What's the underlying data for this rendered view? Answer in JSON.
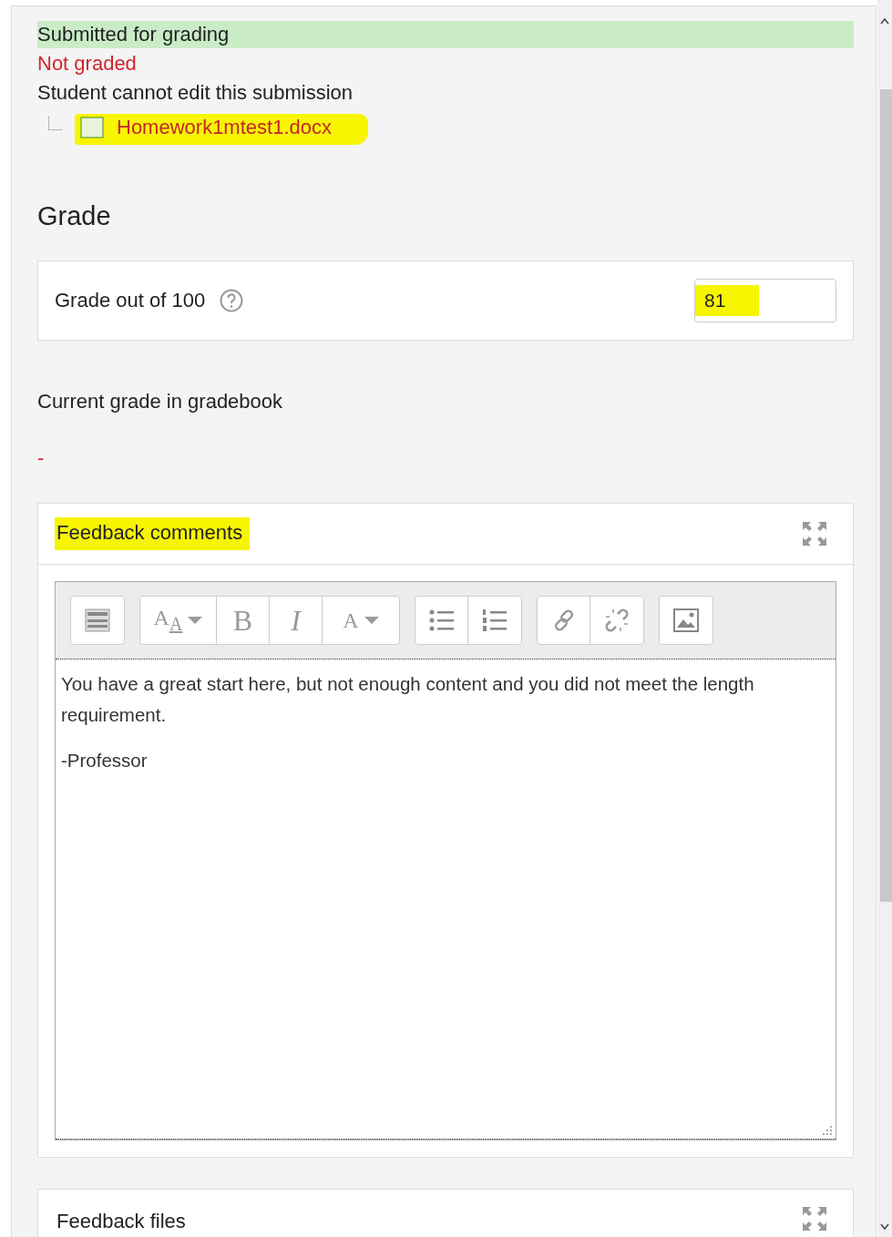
{
  "submission": {
    "status": "Submitted for grading",
    "grading_status": "Not graded",
    "edit_note": "Student cannot edit this submission",
    "files": [
      {
        "name": "Homework1mtest1.docx",
        "highlighted": true
      }
    ]
  },
  "grade": {
    "heading": "Grade",
    "label": "Grade out of 100",
    "value": "81",
    "value_highlighted": true,
    "current_label": "Current grade in gradebook",
    "current_value": "-"
  },
  "feedback_comments": {
    "title": "Feedback comments",
    "title_highlighted": true,
    "toolbar": [
      [
        {
          "kind": "icon"
        }
      ],
      [
        {
          "kind": "dropdown",
          "label": "A$_{A}$",
          "caret": true
        },
        {
          "kind": "bold",
          "label": "B"
        },
        {
          "kind": "italic",
          "label": "I"
        },
        {
          "kind": "dropdown",
          "label": "A",
          "caret": true
        }
      ],
      [
        {
          "kind": "icon"
        },
        {
          "kind": "icon"
        }
      ],
      [
        {
          "kind": "icon"
        },
        {
          "kind": "icon"
        }
      ],
      [
        {
          "kind": "icon"
        }
      ]
    ],
    "paragraphs": [
      "You have a great start here, but not enough content and you did not meet the length requirement.",
      "-Professor"
    ]
  },
  "feedback_files": {
    "title": "Feedback files"
  }
}
